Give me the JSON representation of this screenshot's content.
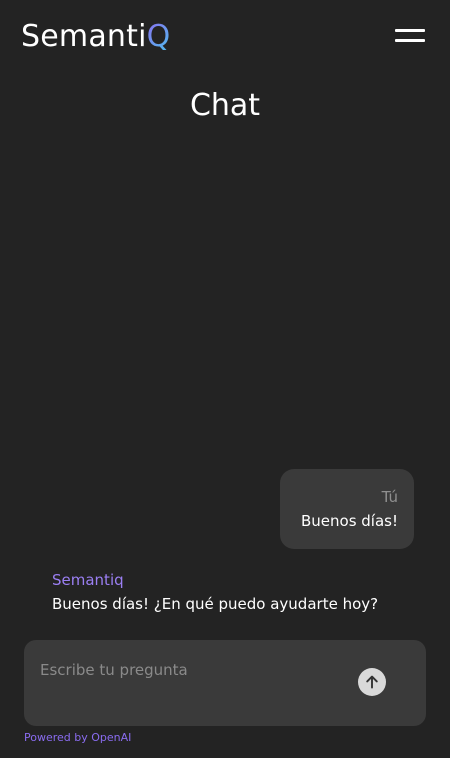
{
  "header": {
    "logo_text_main": "Semanti",
    "logo_text_q": "Q",
    "menu_icon": "hamburger-menu-icon"
  },
  "page": {
    "title": "Chat"
  },
  "messages": [
    {
      "sender": "Tú",
      "text": "Buenos días!"
    },
    {
      "sender": "Semantiq",
      "text": "Buenos días! ¿En qué puedo ayudarte hoy?"
    }
  ],
  "composer": {
    "placeholder": "Escribe tu pregunta",
    "value": "",
    "send_icon": "arrow-up-icon"
  },
  "footer": {
    "credit": "Powered by OpenAI"
  },
  "colors": {
    "background": "#232323",
    "bubble": "#3a3a3a",
    "accent_purple": "#9b7ff3",
    "accent_cyan": "#4cc2ee",
    "placeholder": "#8a8a8a"
  }
}
